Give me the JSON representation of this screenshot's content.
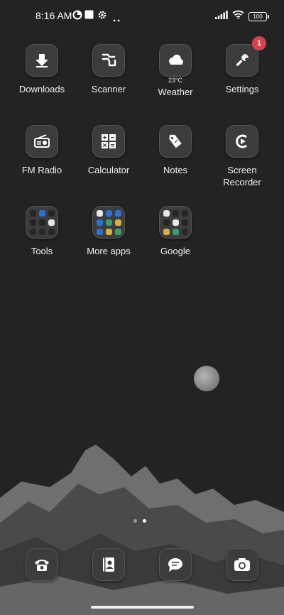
{
  "status_bar": {
    "time": "8:16 AM",
    "battery": "100"
  },
  "apps": {
    "downloads": {
      "label": "Downloads"
    },
    "scanner": {
      "label": "Scanner"
    },
    "weather": {
      "label": "Weather",
      "temp": "23°C"
    },
    "settings": {
      "label": "Settings",
      "badge": "1"
    },
    "fm_radio": {
      "label": "FM Radio"
    },
    "calculator": {
      "label": "Calculator"
    },
    "notes": {
      "label": "Notes"
    },
    "screen_recorder": {
      "label_line1": "Screen",
      "label_line2": "Recorder"
    },
    "tools_folder": {
      "label": "Tools"
    },
    "more_apps_folder": {
      "label": "More apps"
    },
    "google_folder": {
      "label": "Google"
    }
  },
  "dock": {
    "items": [
      "phone-icon",
      "contacts-icon",
      "messages-icon",
      "camera-icon"
    ]
  },
  "page_indicator": {
    "pages": 2,
    "current": 2
  }
}
